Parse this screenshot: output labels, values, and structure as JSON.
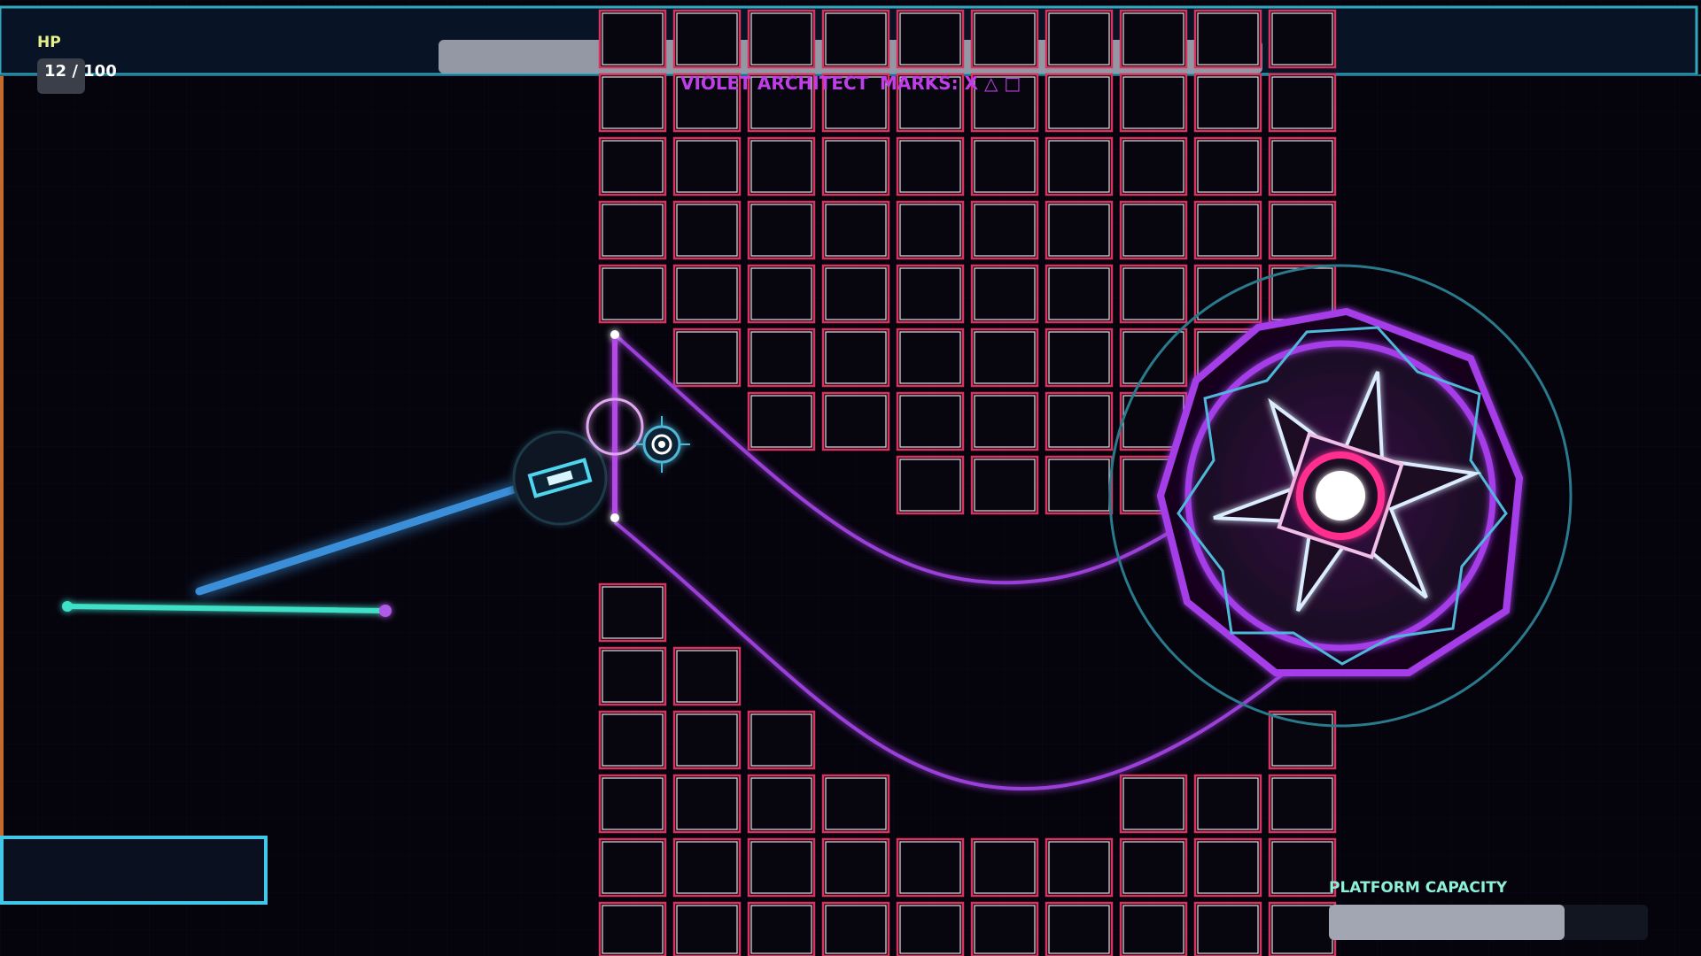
{
  "hud": {
    "hp_label": "HP",
    "hp_current": 12,
    "hp_max": 100,
    "hp_text": "12 / 100",
    "boss_bar_fill": 1.0
  },
  "boss": {
    "name": "VIOLET ARCHITECT",
    "marks_text": "MARKS: X  △  □"
  },
  "platform": {
    "capacity_label": "PLATFORM CAPACITY",
    "capacity_fill": 0.74
  },
  "colors": {
    "background": "#05030c",
    "cyan": "#3fd0e6",
    "magenta_block": "#d8335e",
    "violet": "#a23ee0",
    "hp_label": "#e8f08a",
    "capacity_label": "#8ef0d8"
  },
  "icons": {
    "player": "player-ship-icon",
    "crosshair": "crosshair-icon",
    "boss_core": "boss-core-icon"
  }
}
